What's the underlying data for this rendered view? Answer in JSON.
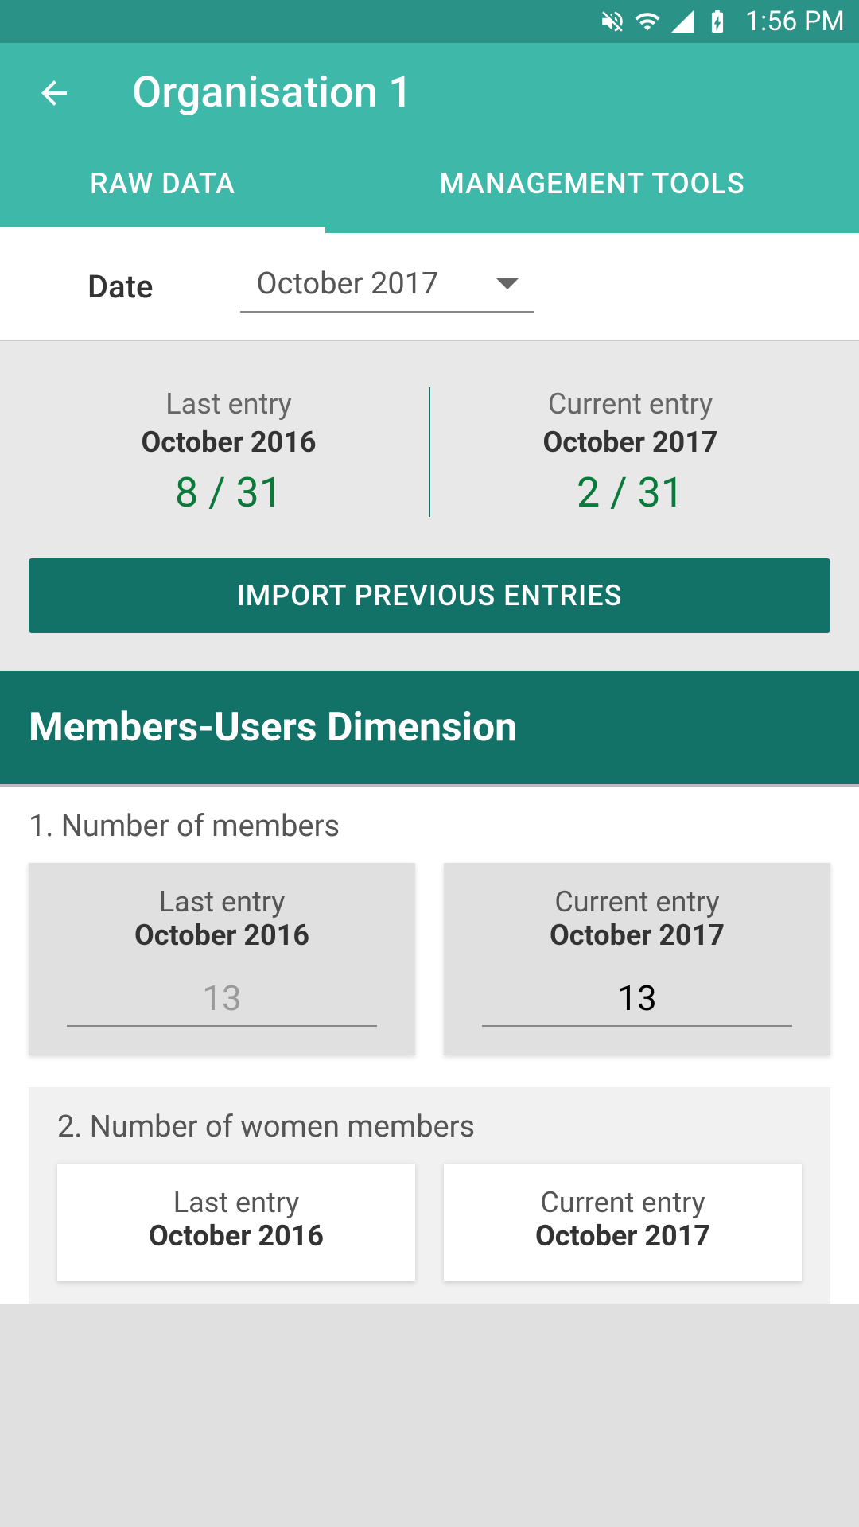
{
  "statusBar": {
    "time": "1:56 PM"
  },
  "header": {
    "title": "Organisation 1"
  },
  "tabs": {
    "rawData": "RAW DATA",
    "managementTools": "MANAGEMENT TOOLS"
  },
  "dateSection": {
    "label": "Date",
    "value": "October 2017"
  },
  "entrySummary": {
    "lastEntry": {
      "label": "Last entry",
      "date": "October 2016",
      "count": "8 / 31"
    },
    "currentEntry": {
      "label": "Current entry",
      "date": "October 2017",
      "count": "2 / 31"
    },
    "importBtn": "IMPORT PREVIOUS ENTRIES"
  },
  "sectionHeader": "Members-Users Dimension",
  "questions": [
    {
      "title": "1. Number of members",
      "lastEntry": {
        "label": "Last entry",
        "date": "October 2016",
        "value": "13"
      },
      "currentEntry": {
        "label": "Current entry",
        "date": "October 2017",
        "value": "13"
      }
    },
    {
      "title": "2. Number of women members",
      "lastEntry": {
        "label": "Last entry",
        "date": "October 2016"
      },
      "currentEntry": {
        "label": "Current entry",
        "date": "October 2017"
      }
    }
  ]
}
